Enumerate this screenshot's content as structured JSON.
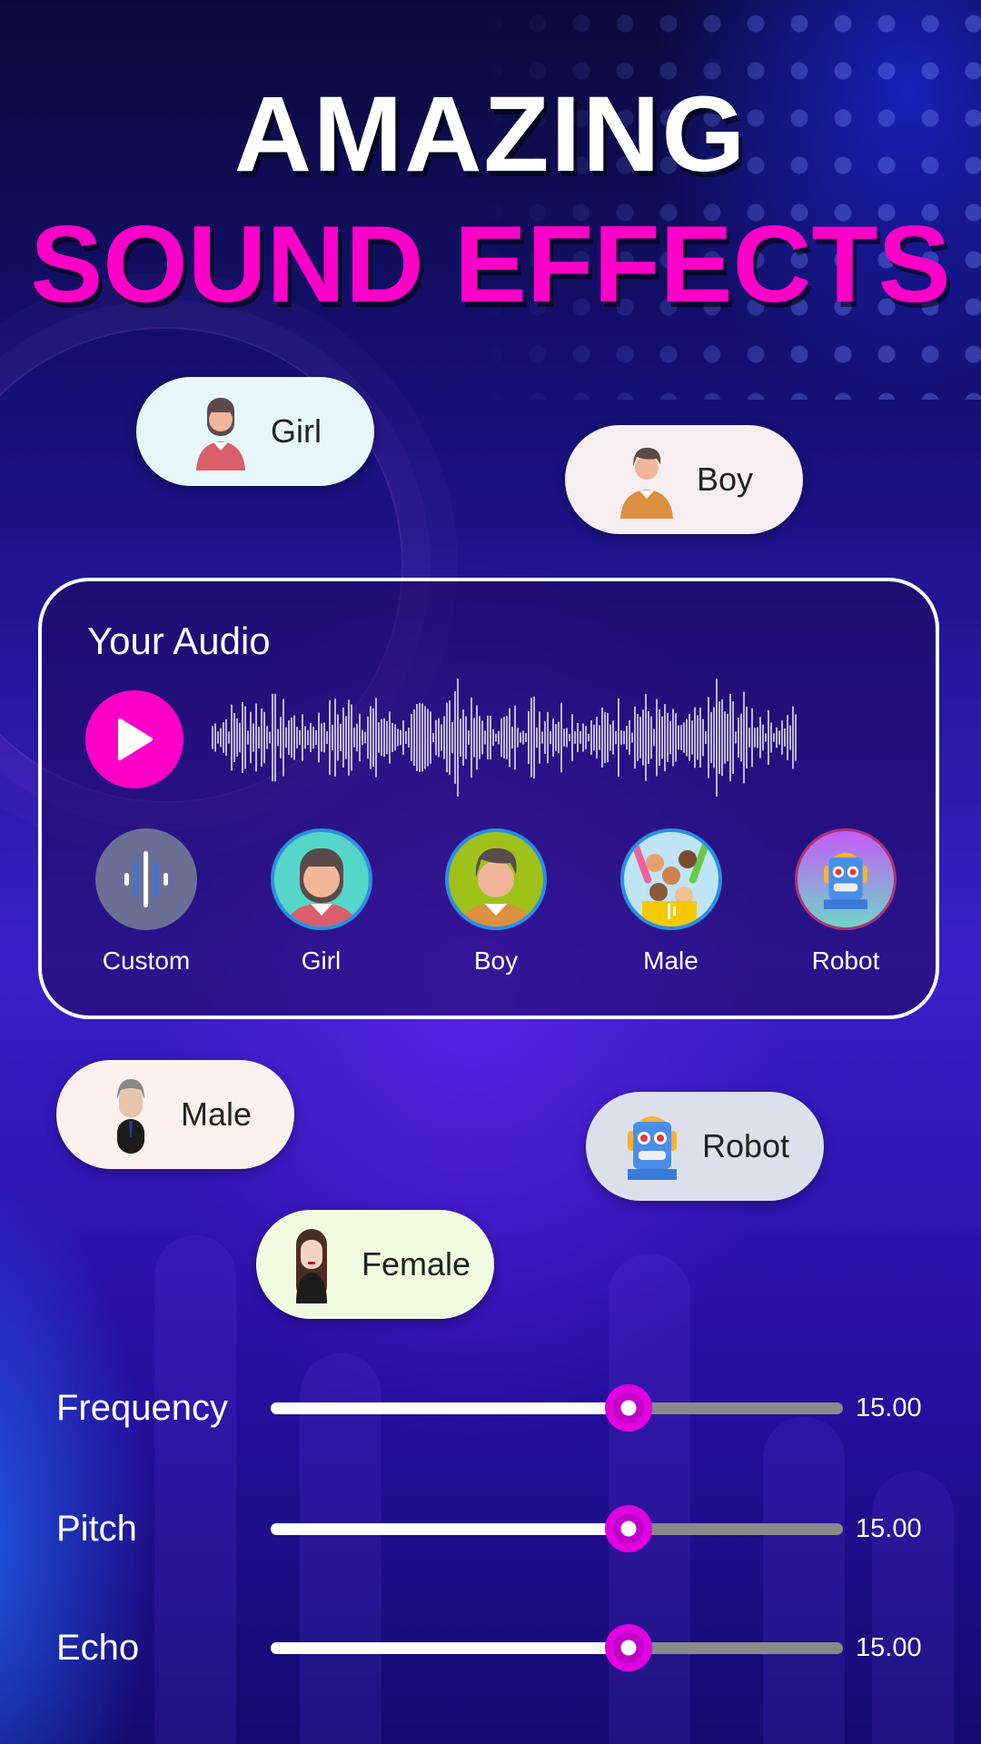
{
  "headline": {
    "line1": "AMAZING",
    "line2": "SOUND EFFECTS",
    "line2_color": "#ff00c8"
  },
  "floating_chips": [
    {
      "label": "Girl",
      "icon": "girl-avatar-icon",
      "bg": "#e8f7fb"
    },
    {
      "label": "Boy",
      "icon": "boy-avatar-icon",
      "bg": "#f6eef1"
    },
    {
      "label": "Male",
      "icon": "male-avatar-icon",
      "bg": "#fdf1ee"
    },
    {
      "label": "Robot",
      "icon": "robot-avatar-icon",
      "bg": "#dde0ea"
    },
    {
      "label": "Female",
      "icon": "female-avatar-icon",
      "bg": "#f2fbdf"
    }
  ],
  "audio_card": {
    "title": "Your Audio",
    "play_icon": "play-icon",
    "accent": "#ff00c8",
    "effects": [
      {
        "label": "Custom",
        "icon": "sound-wave-icon"
      },
      {
        "label": "Girl",
        "icon": "girl-avatar-icon"
      },
      {
        "label": "Boy",
        "icon": "boy-avatar-icon"
      },
      {
        "label": "Male",
        "icon": "crowd-avatar-icon"
      },
      {
        "label": "Robot",
        "icon": "robot-avatar-icon"
      }
    ]
  },
  "sliders": [
    {
      "label": "Frequency",
      "value_text": "15.00",
      "fraction": 0.625
    },
    {
      "label": "Pitch",
      "value_text": "15.00",
      "fraction": 0.625
    },
    {
      "label": "Echo",
      "value_text": "15.00",
      "fraction": 0.625
    }
  ]
}
